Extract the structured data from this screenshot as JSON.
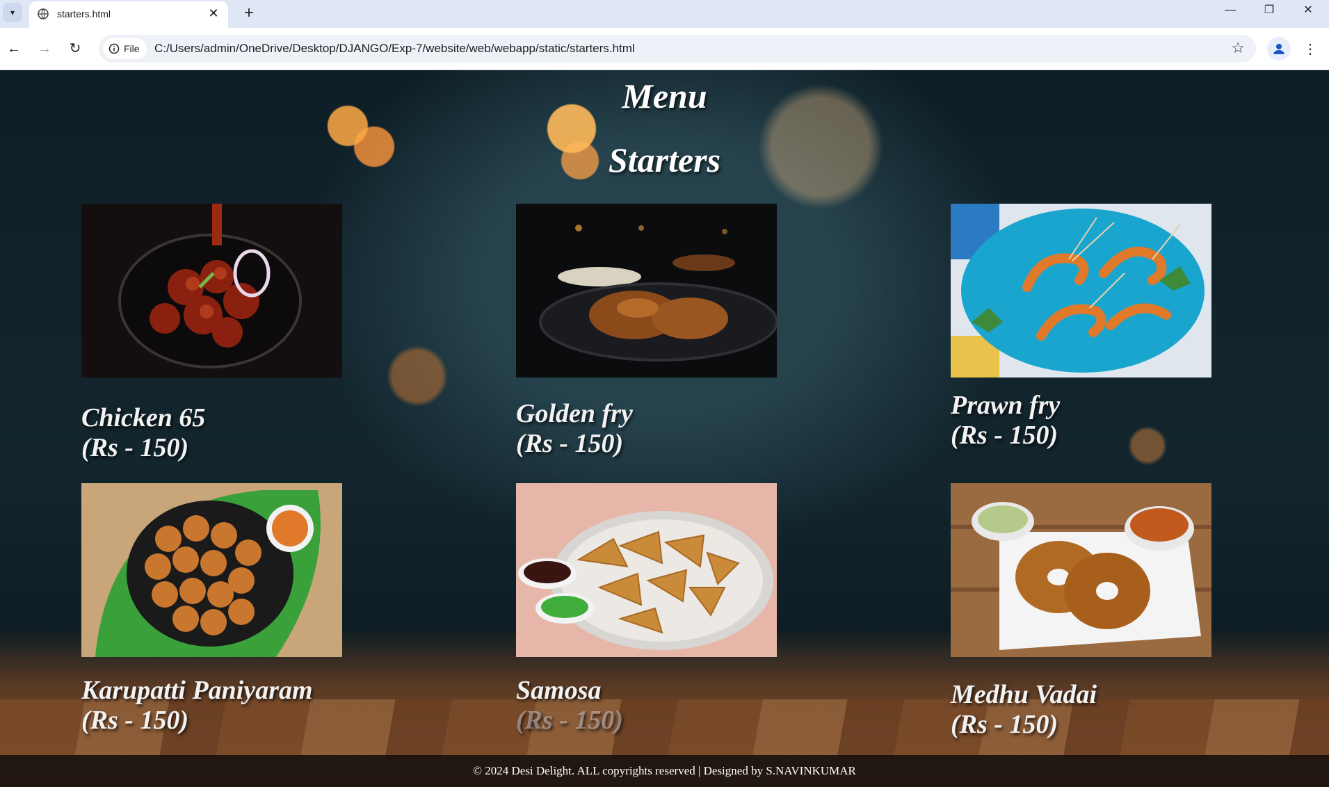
{
  "browser": {
    "tab_title": "starters.html",
    "site_info_label": "File",
    "url": "C:/Users/admin/OneDrive/Desktop/DJANGO/Exp-7/website/web/webapp/static/starters.html"
  },
  "page": {
    "title": "Menu",
    "subtitle": "Starters",
    "items": [
      {
        "name": "Chicken 65",
        "price": "(Rs - 150)"
      },
      {
        "name": "Golden fry",
        "price": "(Rs - 150)"
      },
      {
        "name": "Prawn fry",
        "price": "(Rs - 150)"
      },
      {
        "name": "Karupatti Paniyaram",
        "price": "(Rs - 150)"
      },
      {
        "name": "Samosa",
        "price": "(Rs - 150)"
      },
      {
        "name": "Medhu Vadai",
        "price": "(Rs - 150)"
      }
    ],
    "footer": "© 2024 Desi Delight. ALL copyrights reserved | Designed by S.NAVINKUMAR"
  },
  "colors": {
    "tabbar": "#dfe7f6",
    "page_dark": "#0e1e26",
    "text": "#ffffff",
    "footer_bg": "#19120e"
  }
}
